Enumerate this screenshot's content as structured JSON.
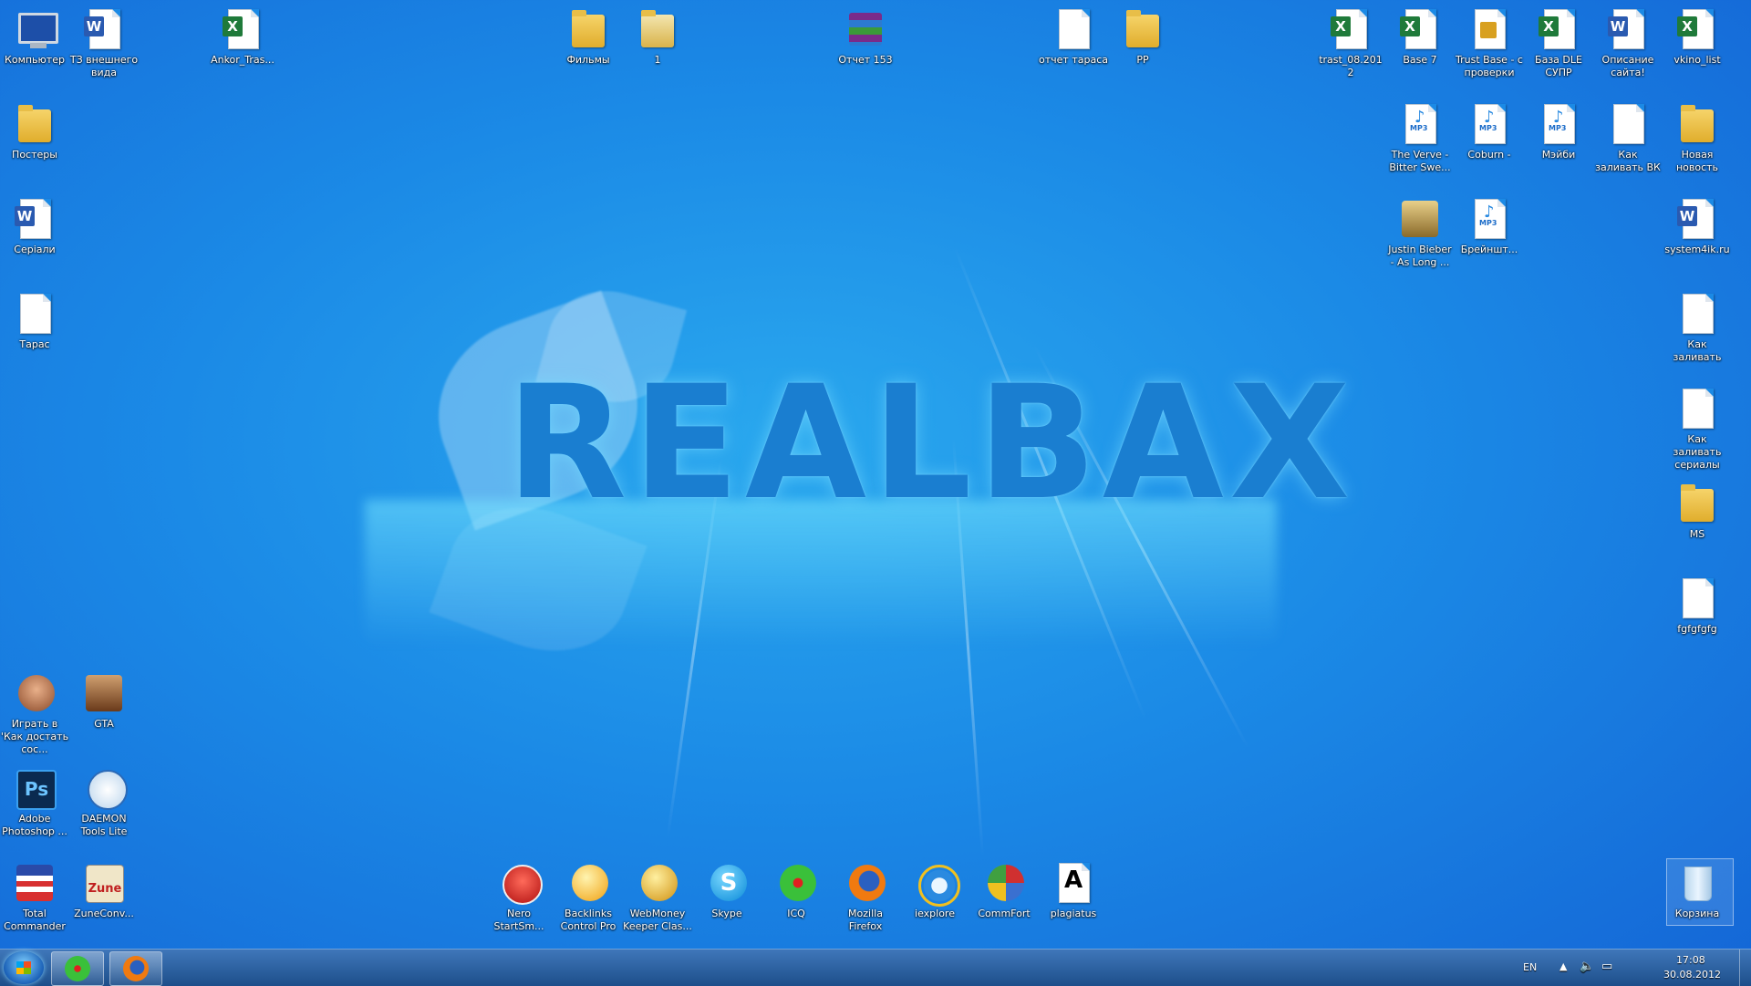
{
  "wallpaper": {
    "text": "REALBAX"
  },
  "desktop_icons": {
    "computer": "Компьютер",
    "tz_doc": "ТЗ внешнего вида",
    "ankor": "Ankor_Tras...",
    "films": "Фильмы",
    "one": "1",
    "otchet153": "Отчет 153",
    "otchet_tarasa": "отчет тараса",
    "pp": "PP",
    "trast": "trast_08.2012",
    "base7": "Base 7",
    "trust_base": "Trust Base - с проверки",
    "baza_dle": "База DLE СУПР",
    "opisanie": "Описание сайта!",
    "vkino": "vkino_list",
    "postery": "Постеры",
    "verve": "The Verve - Bitter Swe...",
    "coburn": "Coburn -",
    "meybi": "Мэйби",
    "kak_zalivat_vk": "Как заливать ВК",
    "novaya": "Новая новость",
    "seriali": "Сеpiали",
    "bieber": "Justin Bieber - As Long ...",
    "brainsht": "Брейншт...",
    "system4ik": "system4ik.ru",
    "taras": "Тарас",
    "kak_zalivat": "Как заливать",
    "kak_zalivat_serialy": "Как заливать сериалы",
    "ms": "MS",
    "fgfg": "fgfgfgfg",
    "igrat": "Играть в 'Как достать сос...",
    "gta": "GTA",
    "photoshop": "Adobe Photoshop ...",
    "daemon": "DAEMON Tools Lite",
    "total": "Total Commander",
    "zune": "ZuneConv...",
    "nero": "Nero StartSm...",
    "backlinks": "Backlinks Control Pro",
    "webmoney": "WebMoney Keeper Clas...",
    "skype": "Skype",
    "icq": "ICQ",
    "firefox": "Mozilla Firefox",
    "iexplore": "iexplore",
    "commfort": "CommFort",
    "plagiatus": "plagiatus",
    "korzina": "Корзина"
  },
  "icon_glyphs": {
    "ps": "Ps",
    "zune": "Zune",
    "plag": "A"
  },
  "taskbar": {
    "lang": "EN",
    "time": "17:08",
    "date": "30.08.2012"
  }
}
